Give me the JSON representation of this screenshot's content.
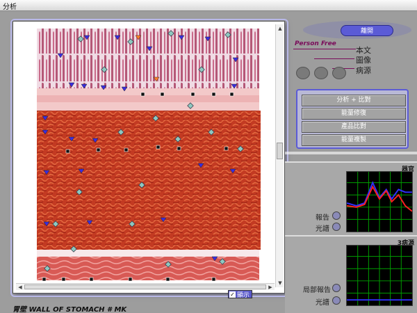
{
  "window": {
    "title": "分析"
  },
  "viewer": {
    "zoom_icon": "magnifier-icon",
    "label_toggle": {
      "label": "顯示",
      "checked": true
    }
  },
  "specimen": {
    "label": "胃壁 WALL OF STOMACH  # MK"
  },
  "close_button": {
    "label": "離開"
  },
  "brand": {
    "label": "Person Free"
  },
  "view_options": [
    {
      "label": "本文"
    },
    {
      "label": "圖像"
    },
    {
      "label": "病源"
    }
  ],
  "menu": {
    "items": [
      "分析 + 比對",
      "能量修復",
      "產品比對",
      "能量複製"
    ]
  },
  "panel_top": {
    "title": "器官",
    "buttons": [
      {
        "label": "報告"
      },
      {
        "label": "光譜"
      }
    ]
  },
  "panel_bottom": {
    "title": "3病源",
    "buttons": [
      {
        "label": "局部報告"
      },
      {
        "label": "光譜"
      }
    ]
  },
  "colors": {
    "accent": "#5b5bd6",
    "brand": "#7a0c5a",
    "graph_red": "#ff2020",
    "graph_blue": "#3030ff",
    "graph_grid": "#00a000"
  }
}
